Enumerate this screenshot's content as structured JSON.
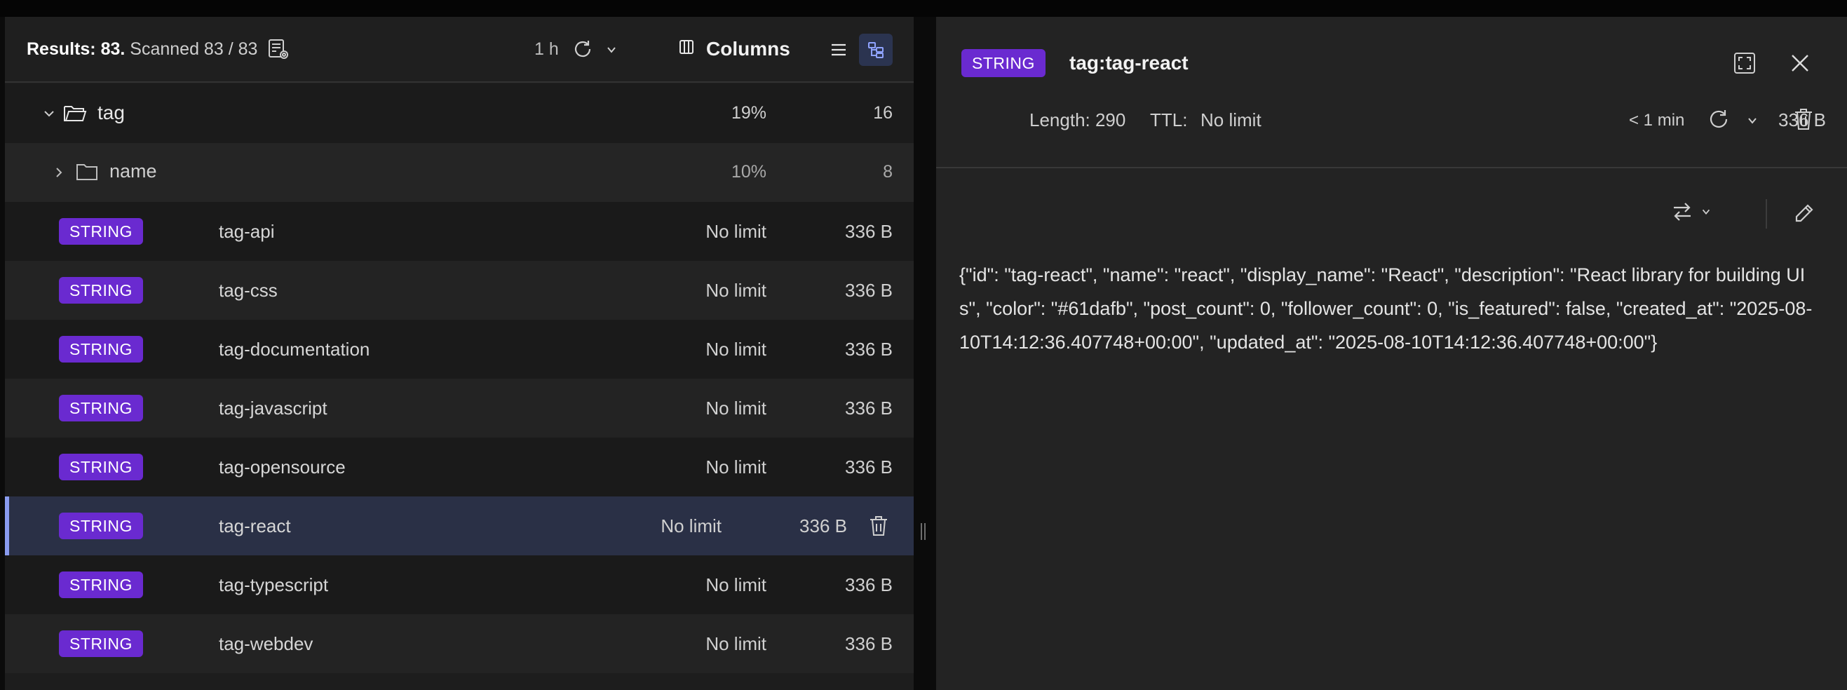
{
  "toolbar": {
    "results_label": "Results: 83.",
    "scanned_label": "Scanned 83 / 83",
    "refresh_interval": "1 h",
    "columns_label": "Columns"
  },
  "tree": {
    "folder": {
      "name": "tag",
      "percent": "19%",
      "count": "16"
    },
    "subfolder": {
      "name": "name",
      "percent": "10%",
      "count": "8"
    },
    "keys": [
      {
        "type": "STRING",
        "name": "tag-api",
        "ttl": "No limit",
        "size": "336 B"
      },
      {
        "type": "STRING",
        "name": "tag-css",
        "ttl": "No limit",
        "size": "336 B"
      },
      {
        "type": "STRING",
        "name": "tag-documentation",
        "ttl": "No limit",
        "size": "336 B"
      },
      {
        "type": "STRING",
        "name": "tag-javascript",
        "ttl": "No limit",
        "size": "336 B"
      },
      {
        "type": "STRING",
        "name": "tag-opensource",
        "ttl": "No limit",
        "size": "336 B"
      },
      {
        "type": "STRING",
        "name": "tag-react",
        "ttl": "No limit",
        "size": "336 B"
      },
      {
        "type": "STRING",
        "name": "tag-typescript",
        "ttl": "No limit",
        "size": "336 B"
      },
      {
        "type": "STRING",
        "name": "tag-webdev",
        "ttl": "No limit",
        "size": "336 B"
      }
    ]
  },
  "details": {
    "type": "STRING",
    "key": "tag:tag-react",
    "size": "336 B",
    "length": "Length: 290",
    "ttl_label": "TTL:",
    "ttl_value": "No limit",
    "last_refresh": "< 1 min",
    "value": "{\"id\": \"tag-react\", \"name\": \"react\", \"display_name\": \"React\", \"description\": \"React library for building UIs\", \"color\": \"#61dafb\", \"post_count\": 0, \"follower_count\": 0, \"is_featured\": false, \"created_at\": \"2025-08-10T14:12:36.407748+00:00\", \"updated_at\": \"2025-08-10T14:12:36.407748+00:00\"}"
  },
  "colors": {
    "badge": "#6a2ad0",
    "selected_row": "#2a3046",
    "selected_accent": "#8a9cf0"
  },
  "icons": [
    "scan-settings-icon",
    "refresh-icon",
    "chevron-down-icon",
    "columns-icon",
    "list-view-icon",
    "tree-view-icon",
    "folder-icon",
    "chevron-right-icon",
    "delete-icon",
    "expand-icon",
    "close-icon",
    "format-icon",
    "edit-icon"
  ]
}
